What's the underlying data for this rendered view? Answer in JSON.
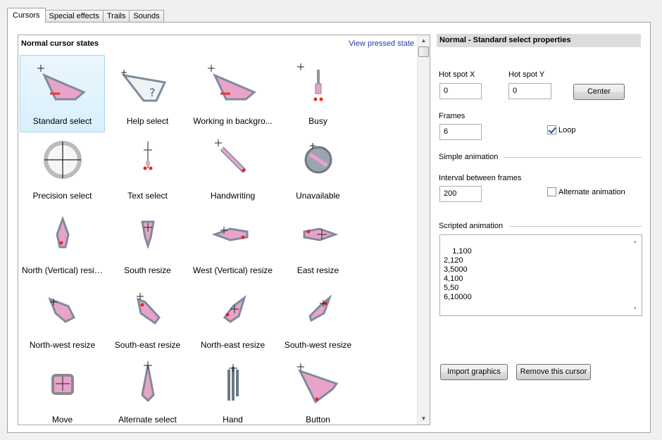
{
  "tabs": [
    "Cursors",
    "Special effects",
    "Trails",
    "Sounds"
  ],
  "list": {
    "title": "Normal cursor states",
    "view_link": "View pressed state",
    "cursors": [
      {
        "label": "Standard select",
        "icon": "standard-select-icon"
      },
      {
        "label": "Help select",
        "icon": "help-select-icon"
      },
      {
        "label": "Working in backgro...",
        "icon": "working-in-background-icon"
      },
      {
        "label": "Busy",
        "icon": "busy-icon"
      },
      {
        "label": "Precision select",
        "icon": "precision-select-icon"
      },
      {
        "label": "Text select",
        "icon": "text-select-icon"
      },
      {
        "label": "Handwriting",
        "icon": "handwriting-icon"
      },
      {
        "label": "Unavailable",
        "icon": "unavailable-icon"
      },
      {
        "label": "North (Vertical) resize",
        "icon": "north-resize-icon"
      },
      {
        "label": "South resize",
        "icon": "south-resize-icon"
      },
      {
        "label": "West (Vertical) resize",
        "icon": "west-resize-icon"
      },
      {
        "label": "East resize",
        "icon": "east-resize-icon"
      },
      {
        "label": "North-west resize",
        "icon": "north-west-resize-icon"
      },
      {
        "label": "South-east resize",
        "icon": "south-east-resize-icon"
      },
      {
        "label": "North-east resize",
        "icon": "north-east-resize-icon"
      },
      {
        "label": "South-west resize",
        "icon": "south-west-resize-icon"
      },
      {
        "label": "Move",
        "icon": "move-icon"
      },
      {
        "label": "Alternate select",
        "icon": "alternate-select-icon"
      },
      {
        "label": "Hand",
        "icon": "hand-icon"
      },
      {
        "label": "Button",
        "icon": "button-icon"
      }
    ]
  },
  "props": {
    "header": "Normal - Standard select properties",
    "hotspot_x_label": "Hot spot X",
    "hotspot_x_value": "0",
    "hotspot_y_label": "Hot spot Y",
    "hotspot_y_value": "0",
    "center_button": "Center",
    "frames_label": "Frames",
    "frames_value": "6",
    "loop_label": "Loop",
    "loop_checked": true,
    "simple_animation_label": "Simple animation",
    "interval_label": "Interval between frames",
    "interval_value": "200",
    "alternate_label": "Alternate animation",
    "alternate_checked": false,
    "scripted_label": "Scripted animation",
    "scripted_text": "1,100\n2,120\n3,5000\n4,100\n5,50\n6,10000",
    "import_button": "Import graphics",
    "remove_button": "Remove this cursor"
  },
  "colors": {
    "accent_pink": "#e9a3c9",
    "cursor_outline": "#7d8c9c",
    "selection": "#d9f0fc",
    "link": "#1f3fa8"
  }
}
